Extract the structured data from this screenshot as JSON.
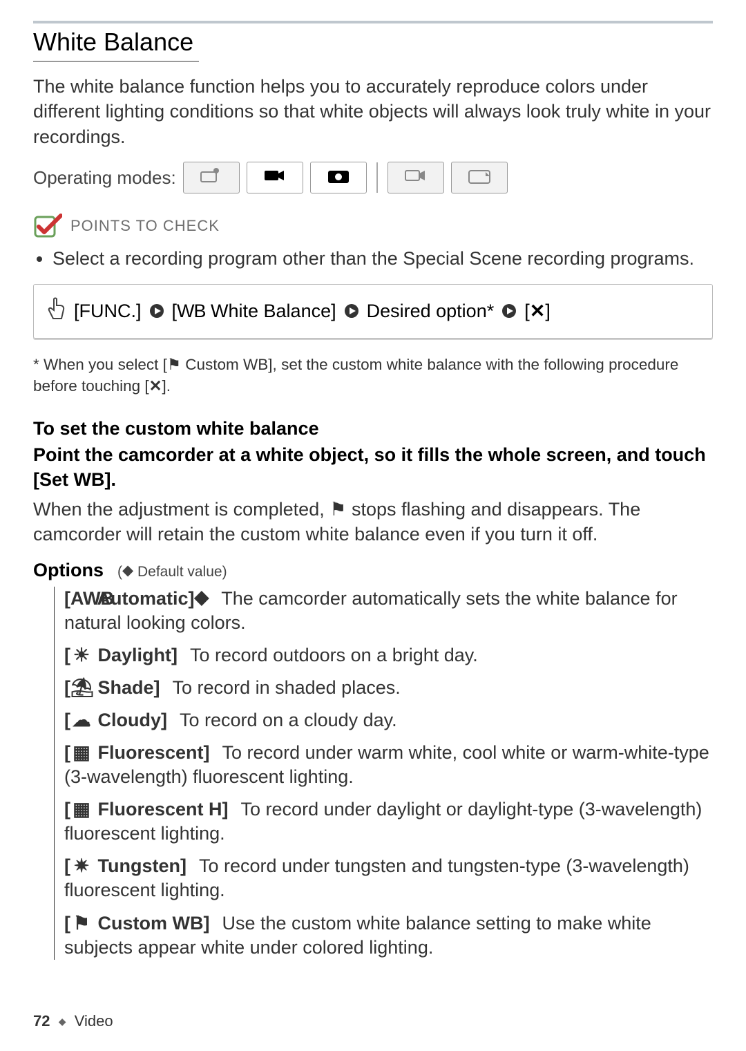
{
  "section": {
    "title": "White Balance",
    "intro": "The white balance function helps you to accurately reproduce colors under different lighting conditions so that white objects will always look truly white in your recordings."
  },
  "modes": {
    "label": "Operating modes:",
    "items": [
      {
        "name": "camera-auto-icon",
        "active": false
      },
      {
        "name": "video-record-icon",
        "active": true
      },
      {
        "name": "photo-record-icon",
        "active": true
      },
      {
        "name": "video-playback-icon",
        "active": false
      },
      {
        "name": "photo-playback-icon",
        "active": false
      }
    ]
  },
  "points_to_check": {
    "label": "POINTS TO CHECK",
    "bullet": "Select a recording program other than the Special Scene recording programs."
  },
  "nav_sequence": {
    "step1": "[FUNC.]",
    "step2_prefix": "[",
    "step2_glyph": "WB",
    "step2_label": " White Balance]",
    "step3": "Desired option*",
    "step4_prefix": "[",
    "step4_glyph": "✕",
    "step4_suffix": "]"
  },
  "footnote": {
    "lead": "* ",
    "part1": "When you select [",
    "custom_wb_glyph": "⚑",
    "custom_wb_label": " Custom WB], ",
    "part2": "set the custom white balance with the following procedure before touching [",
    "close_glyph": "✕",
    "part3": "]."
  },
  "custom_wb": {
    "heading": "To set the custom white balance",
    "instruction": "Point the camcorder at a white object, so it fills the whole screen, and touch [Set WB].",
    "body_a": "When the adjustment is completed, ",
    "body_glyph": "⚑",
    "body_b": " stops flashing and disappears. The camcorder will retain the custom white balance even if you turn it off."
  },
  "options_header": {
    "title": "Options",
    "note_prefix": "(",
    "note_diamond": "◆",
    "note_text": " Default value)"
  },
  "options": [
    {
      "icon": "AWB",
      "name": "Automatic",
      "default": true,
      "desc": "The camcorder automatically sets the white balance for natural looking colors."
    },
    {
      "icon": "☀",
      "name": "Daylight",
      "default": false,
      "desc": "To record outdoors on a bright day."
    },
    {
      "icon": "⛱",
      "name": "Shade",
      "default": false,
      "desc": "To record in shaded places."
    },
    {
      "icon": "☁",
      "name": "Cloudy",
      "default": false,
      "desc": "To record on a cloudy day."
    },
    {
      "icon": "▦",
      "name": "Fluorescent",
      "default": false,
      "desc": "To record under warm white, cool white or warm-white-type (3-wavelength) fluorescent lighting."
    },
    {
      "icon": "▦",
      "name": "Fluorescent H",
      "default": false,
      "desc": "To record under daylight or daylight-type (3-wavelength) fluorescent lighting."
    },
    {
      "icon": "✷",
      "name": "Tungsten",
      "default": false,
      "desc": "To record under tungsten and tungsten-type (3-wavelength) fluorescent lighting."
    },
    {
      "icon": "⚑",
      "name": "Custom WB",
      "default": false,
      "desc": "Use the custom white balance setting to make white subjects appear white under colored lighting."
    }
  ],
  "footer": {
    "page": "72",
    "diamond": "◆",
    "chapter": "Video"
  }
}
